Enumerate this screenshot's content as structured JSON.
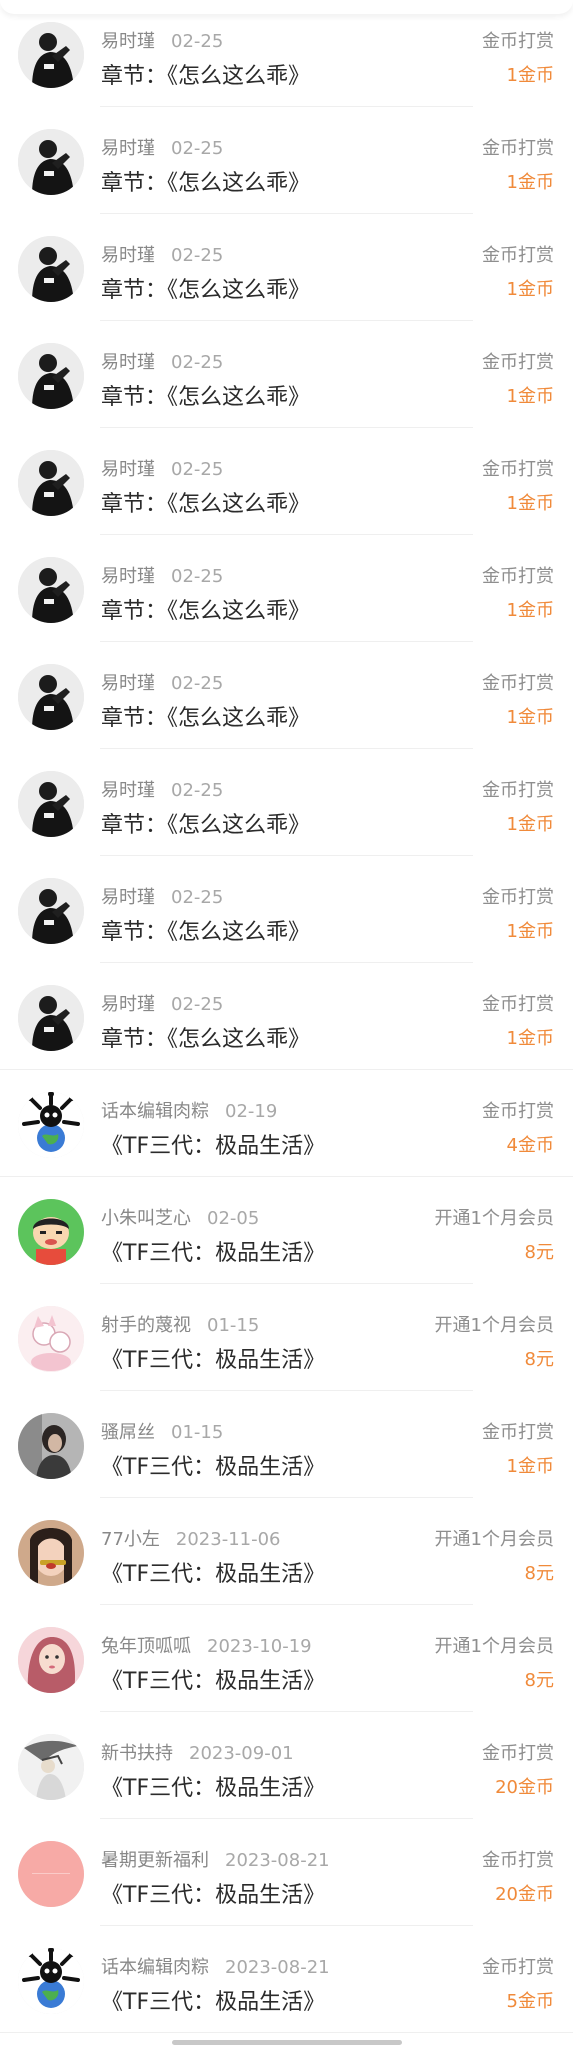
{
  "records": [
    {
      "name": "易时瑾",
      "date": "02-25",
      "title": "章节：《怎么这么乖》",
      "type": "金币打赏",
      "amount": "1金币",
      "avatar": "dark-figure-avatar"
    },
    {
      "name": "易时瑾",
      "date": "02-25",
      "title": "章节：《怎么这么乖》",
      "type": "金币打赏",
      "amount": "1金币",
      "avatar": "dark-figure-avatar"
    },
    {
      "name": "易时瑾",
      "date": "02-25",
      "title": "章节：《怎么这么乖》",
      "type": "金币打赏",
      "amount": "1金币",
      "avatar": "dark-figure-avatar"
    },
    {
      "name": "易时瑾",
      "date": "02-25",
      "title": "章节：《怎么这么乖》",
      "type": "金币打赏",
      "amount": "1金币",
      "avatar": "dark-figure-avatar"
    },
    {
      "name": "易时瑾",
      "date": "02-25",
      "title": "章节：《怎么这么乖》",
      "type": "金币打赏",
      "amount": "1金币",
      "avatar": "dark-figure-avatar"
    },
    {
      "name": "易时瑾",
      "date": "02-25",
      "title": "章节：《怎么这么乖》",
      "type": "金币打赏",
      "amount": "1金币",
      "avatar": "dark-figure-avatar"
    },
    {
      "name": "易时瑾",
      "date": "02-25",
      "title": "章节：《怎么这么乖》",
      "type": "金币打赏",
      "amount": "1金币",
      "avatar": "dark-figure-avatar"
    },
    {
      "name": "易时瑾",
      "date": "02-25",
      "title": "章节：《怎么这么乖》",
      "type": "金币打赏",
      "amount": "1金币",
      "avatar": "dark-figure-avatar"
    },
    {
      "name": "易时瑾",
      "date": "02-25",
      "title": "章节：《怎么这么乖》",
      "type": "金币打赏",
      "amount": "1金币",
      "avatar": "dark-figure-avatar"
    },
    {
      "name": "易时瑾",
      "date": "02-25",
      "title": "章节：《怎么这么乖》",
      "type": "金币打赏",
      "amount": "1金币",
      "avatar": "dark-figure-avatar"
    },
    {
      "name": "话本编辑肉粽",
      "date": "02-19",
      "title": "《TF三代：极品生活》",
      "type": "金币打赏",
      "amount": "4金币",
      "avatar": "globe-mascot-avatar"
    },
    {
      "name": "小朱叫芝心",
      "date": "02-05",
      "title": "《TF三代：极品生活》",
      "type": "开通1个月会员",
      "amount": "8元",
      "avatar": "cartoon-boy-avatar"
    },
    {
      "name": "射手的蔑视",
      "date": "01-15",
      "title": "《TF三代：极品生活》",
      "type": "开通1个月会员",
      "amount": "8元",
      "avatar": "sketch-girl-avatar"
    },
    {
      "name": "骚屌丝",
      "date": "01-15",
      "title": "《TF三代：极品生活》",
      "type": "金币打赏",
      "amount": "1金币",
      "avatar": "photo-person-avatar"
    },
    {
      "name": "77小左",
      "date": "2023-11-06",
      "title": "《TF三代：极品生活》",
      "type": "开通1个月会员",
      "amount": "8元",
      "avatar": "selfie-avatar"
    },
    {
      "name": "兔年顶呱呱",
      "date": "2023-10-19",
      "title": "《TF三代：极品生活》",
      "type": "开通1个月会员",
      "amount": "8元",
      "avatar": "pink-hair-avatar"
    },
    {
      "name": "新书扶持",
      "date": "2023-09-01",
      "title": "《TF三代：极品生活》",
      "type": "金币打赏",
      "amount": "20金币",
      "avatar": "ink-figure-avatar"
    },
    {
      "name": "暑期更新福利",
      "date": "2023-08-21",
      "title": "《TF三代：极品生活》",
      "type": "金币打赏",
      "amount": "20金币",
      "avatar": "pink-circle-avatar"
    },
    {
      "name": "话本编辑肉粽",
      "date": "2023-08-21",
      "title": "《TF三代：极品生活》",
      "type": "金币打赏",
      "amount": "5金币",
      "avatar": "globe-mascot-avatar"
    }
  ],
  "colors": {
    "amount": "#f08a3a",
    "secondary_text": "#9a9a9a",
    "primary_text": "#2b2b2b",
    "divider": "#efefef"
  }
}
